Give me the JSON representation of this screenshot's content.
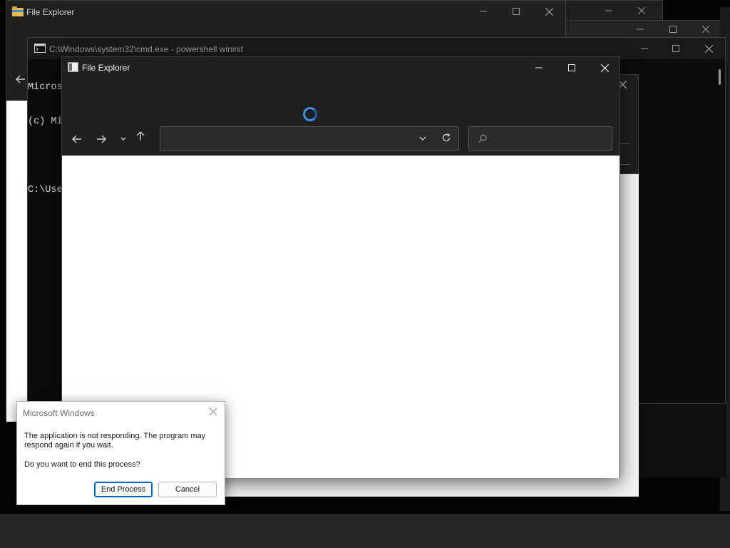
{
  "fe_back": {
    "title": "File Explorer"
  },
  "cmd": {
    "title": "C:\\Windows\\system32\\cmd.exe - powershell  wininit",
    "lines": [
      "Micros",
      "(c) Mi",
      "",
      "C:\\Use"
    ]
  },
  "fe_main": {
    "title": "File Explorer",
    "address_value": "",
    "search_placeholder": ""
  },
  "dialog": {
    "title": "Microsoft Windows",
    "message": "The application is not responding. The program may respond again if you wait.",
    "question": "Do you want to end this process?",
    "end_button": "End Process",
    "cancel_button": "Cancel"
  },
  "colors": {
    "accent": "#0067c0",
    "spinner": "#3b8fe0",
    "dark_chrome": "#202020",
    "console_bg": "#0c0c0c"
  },
  "icons": {
    "folder": "folder-icon",
    "console": "console-icon",
    "explorer": "explorer-icon",
    "minimize": "minimize-icon",
    "maximize": "maximize-icon",
    "close": "close-icon",
    "back": "back-arrow-icon",
    "forward": "forward-arrow-icon",
    "recent": "chevron-down-icon",
    "up": "up-arrow-icon",
    "refresh": "refresh-icon",
    "search": "search-icon",
    "spinner": "loading-spinner-icon"
  }
}
